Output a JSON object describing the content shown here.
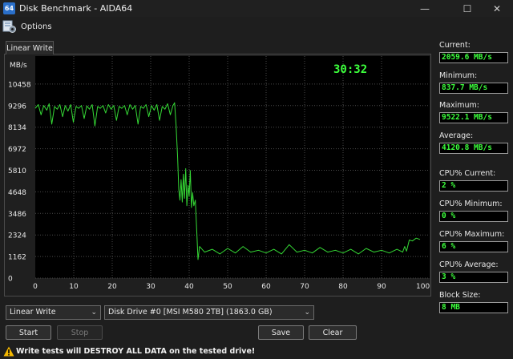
{
  "window": {
    "app_icon_text": "64",
    "title": "Disk Benchmark - AIDA64",
    "minimize_glyph": "—",
    "maximize_glyph": "☐",
    "close_glyph": "✕"
  },
  "toolbar": {
    "options_label": "Options",
    "options_icon": "options-gear-icon"
  },
  "tabs": [
    {
      "label": "Linear Write",
      "active": true
    }
  ],
  "chart_data": {
    "type": "line",
    "ylabel": "MB/s",
    "timer": "30:32",
    "y_ticks": [
      "10458",
      "9296",
      "8134",
      "6972",
      "5810",
      "4648",
      "3486",
      "2324",
      "1162",
      "0"
    ],
    "x_ticks": [
      "0",
      "10",
      "20",
      "30",
      "40",
      "50",
      "60",
      "70",
      "80",
      "90",
      "100 %"
    ],
    "ylim": [
      0,
      11620
    ],
    "xlim": [
      0,
      100
    ],
    "grid": true,
    "line_color": "#35d935",
    "series": [
      {
        "values": [
          [
            0,
            9150
          ],
          [
            0.8,
            9350
          ],
          [
            1.5,
            8800
          ],
          [
            2.2,
            9300
          ],
          [
            3,
            9050
          ],
          [
            3.6,
            9400
          ],
          [
            4.3,
            8300
          ],
          [
            5,
            9250
          ],
          [
            5.7,
            9100
          ],
          [
            6.4,
            9350
          ],
          [
            7.1,
            8700
          ],
          [
            7.8,
            9300
          ],
          [
            8.5,
            9000
          ],
          [
            9.2,
            9350
          ],
          [
            9.9,
            8400
          ],
          [
            10.6,
            9250
          ],
          [
            11.3,
            9150
          ],
          [
            12,
            9300
          ],
          [
            12.7,
            8600
          ],
          [
            13.4,
            9280
          ],
          [
            14.1,
            9100
          ],
          [
            14.8,
            9350
          ],
          [
            15.5,
            8200
          ],
          [
            16.2,
            9250
          ],
          [
            16.9,
            9150
          ],
          [
            17.6,
            9300
          ],
          [
            18.3,
            8900
          ],
          [
            19,
            9350
          ],
          [
            19.7,
            9100
          ],
          [
            20.4,
            9300
          ],
          [
            21.1,
            8500
          ],
          [
            21.8,
            9250
          ],
          [
            22.5,
            9150
          ],
          [
            23.2,
            9300
          ],
          [
            23.9,
            8800
          ],
          [
            24.6,
            9350
          ],
          [
            25.3,
            9100
          ],
          [
            26,
            9300
          ],
          [
            26.7,
            8300
          ],
          [
            27.4,
            9250
          ],
          [
            28.1,
            9150
          ],
          [
            28.8,
            9350
          ],
          [
            29.5,
            8700
          ],
          [
            30.2,
            9300
          ],
          [
            30.9,
            9050
          ],
          [
            31.6,
            9350
          ],
          [
            32.3,
            8500
          ],
          [
            33,
            9250
          ],
          [
            33.7,
            9100
          ],
          [
            34.4,
            9400
          ],
          [
            35.1,
            8800
          ],
          [
            35.8,
            9300
          ],
          [
            36.2,
            9450
          ],
          [
            36.6,
            8200
          ],
          [
            37.0,
            6500
          ],
          [
            37.3,
            4800
          ],
          [
            37.6,
            4200
          ],
          [
            37.9,
            5300
          ],
          [
            38.2,
            4100
          ],
          [
            38.5,
            5600
          ],
          [
            38.8,
            4300
          ],
          [
            39.1,
            5900
          ],
          [
            39.4,
            3900
          ],
          [
            39.7,
            5000
          ],
          [
            40.0,
            4400
          ],
          [
            40.3,
            5800
          ],
          [
            40.6,
            3800
          ],
          [
            40.9,
            4600
          ],
          [
            41.2,
            3900
          ],
          [
            41.6,
            4200
          ],
          [
            42.0,
            2400
          ],
          [
            42.3,
            1000
          ],
          [
            42.7,
            1700
          ],
          [
            44,
            1400
          ],
          [
            46,
            1550
          ],
          [
            48,
            1300
          ],
          [
            50,
            1600
          ],
          [
            52,
            1350
          ],
          [
            54,
            1700
          ],
          [
            56,
            1400
          ],
          [
            58,
            1500
          ],
          [
            60,
            1350
          ],
          [
            62,
            1550
          ],
          [
            64,
            1300
          ],
          [
            66,
            1800
          ],
          [
            68,
            1400
          ],
          [
            70,
            1500
          ],
          [
            72,
            1350
          ],
          [
            74,
            1650
          ],
          [
            76,
            1400
          ],
          [
            78,
            1500
          ],
          [
            80,
            1350
          ],
          [
            82,
            1550
          ],
          [
            84,
            1300
          ],
          [
            86,
            1600
          ],
          [
            88,
            1400
          ],
          [
            90,
            1500
          ],
          [
            92,
            1350
          ],
          [
            94,
            1550
          ],
          [
            95.5,
            1400
          ],
          [
            96,
            1700
          ],
          [
            96.5,
            1450
          ],
          [
            97.2,
            2050
          ],
          [
            98,
            2000
          ],
          [
            99,
            2150
          ],
          [
            100,
            2080
          ]
        ]
      }
    ]
  },
  "stats": [
    {
      "label": "Current:",
      "value": "2059.6 MB/s"
    },
    {
      "label": "Minimum:",
      "value": "837.7 MB/s"
    },
    {
      "label": "Maximum:",
      "value": "9522.1 MB/s"
    },
    {
      "label": "Average:",
      "value": "4120.8 MB/s"
    },
    {
      "label": "CPU% Current:",
      "value": "2 %"
    },
    {
      "label": "CPU% Minimum:",
      "value": "0 %"
    },
    {
      "label": "CPU% Maximum:",
      "value": "6 %"
    },
    {
      "label": "CPU% Average:",
      "value": "3 %"
    },
    {
      "label": "Block Size:",
      "value": "8 MB"
    }
  ],
  "controls": {
    "test_select": "Linear Write",
    "drive_select": "Disk Drive #0  [MSI M580 2TB]  (1863.0 GB)",
    "start_label": "Start",
    "stop_label": "Stop",
    "save_label": "Save",
    "clear_label": "Clear"
  },
  "warning": {
    "text": "Write tests will DESTROY ALL DATA on the tested drive!",
    "icon": "warning-triangle-icon",
    "color": "#f5b800"
  }
}
